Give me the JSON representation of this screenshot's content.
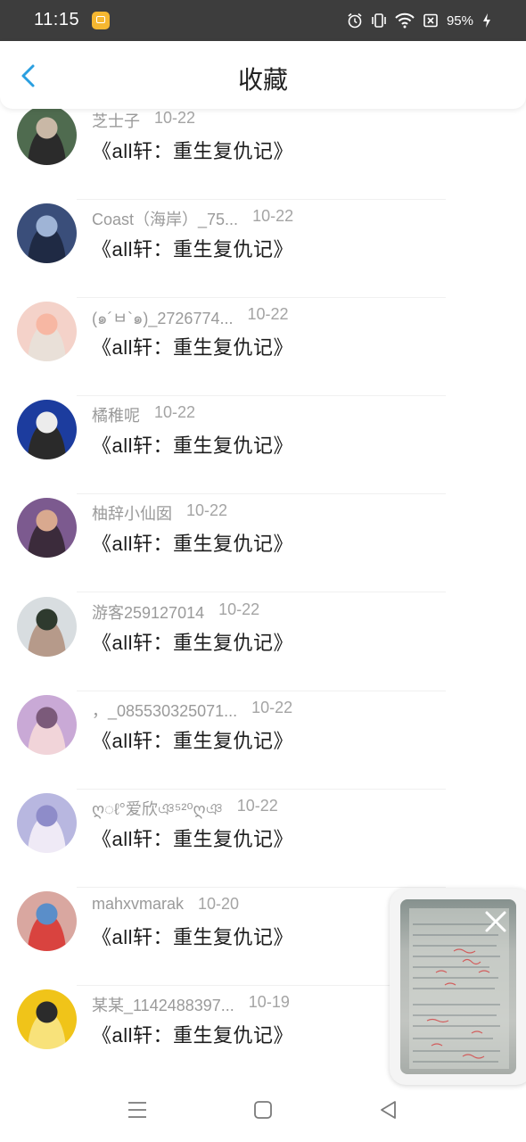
{
  "status_bar": {
    "time": "11:15",
    "battery": "95%",
    "icons": [
      "app-notification-icon",
      "alarm-icon",
      "vibrate-icon",
      "wifi-icon",
      "no-sim-icon",
      "charging-icon"
    ]
  },
  "header": {
    "title": "收藏",
    "back_icon": "chevron-left-icon",
    "accent_color": "#2a9fe0"
  },
  "items": [
    {
      "user": "芝士子",
      "date": "10-22",
      "work": "《all轩：重生复仇记》",
      "avatar_icon": "avatar-photo"
    },
    {
      "user": "Coast（海岸）_75...",
      "date": "10-22",
      "work": "《all轩：重生复仇记》",
      "avatar_icon": "avatar-photo"
    },
    {
      "user": "(๑´ㅂ`๑)_2726774...",
      "date": "10-22",
      "work": "《all轩：重生复仇记》",
      "avatar_icon": "avatar-photo"
    },
    {
      "user": "橘稚呢",
      "date": "10-22",
      "work": "《all轩：重生复仇记》",
      "avatar_icon": "avatar-photo"
    },
    {
      "user": "柚辞小仙囡",
      "date": "10-22",
      "work": "《all轩：重生复仇记》",
      "avatar_icon": "avatar-photo"
    },
    {
      "user": "游客259127014",
      "date": "10-22",
      "work": "《all轩：重生复仇记》",
      "avatar_icon": "avatar-photo"
    },
    {
      "user": "，_085530325071...",
      "date": "10-22",
      "work": "《all轩：重生复仇记》",
      "avatar_icon": "avatar-photo"
    },
    {
      "user": "ღ◌ℓ°爱欣ঞ⁵²⁰ღঞ",
      "date": "10-22",
      "work": "《all轩：重生复仇记》",
      "avatar_icon": "avatar-photo"
    },
    {
      "user": "mahxvmarak",
      "date": "10-20",
      "work": "《all轩：重生复仇记》",
      "avatar_icon": "avatar-photo"
    },
    {
      "user": "某某_1142488397...",
      "date": "10-19",
      "work": "《all轩：重生复仇记》",
      "avatar_icon": "avatar-photo"
    }
  ],
  "floating_preview": {
    "close_icon": "close-icon"
  },
  "nav_bar": {
    "icons": [
      "menu-icon",
      "home-square-icon",
      "back-triangle-icon"
    ]
  }
}
